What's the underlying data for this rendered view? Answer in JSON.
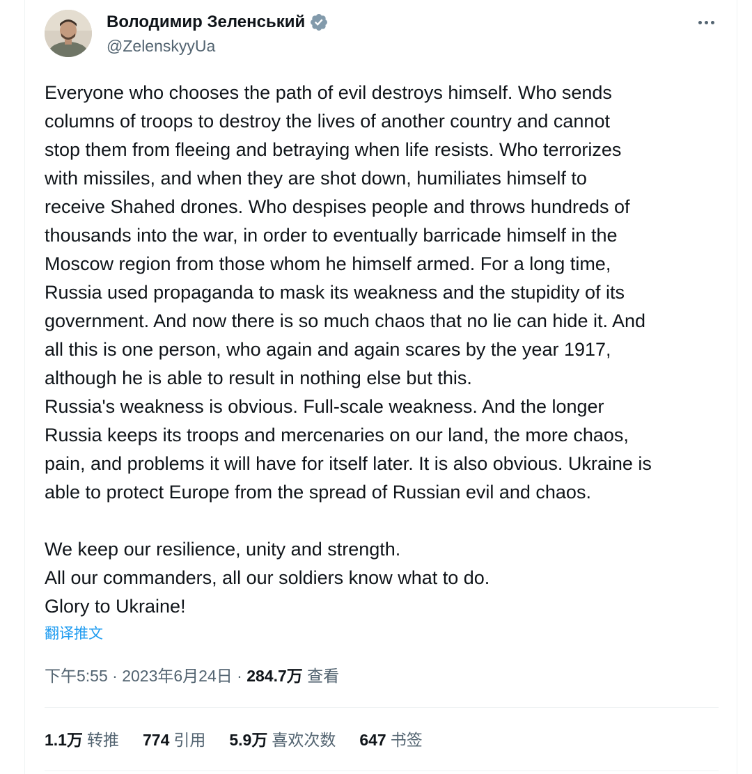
{
  "author": {
    "name": "Володимир Зеленський",
    "handle": "@ZelenskyyUa",
    "verified_icon": "verified-badge-icon",
    "avatar_icon": "avatar"
  },
  "more_icon": "more-options-icon",
  "tweet": {
    "paragraphs": [
      "Everyone who chooses the path of evil destroys himself. Who sends",
      "columns of troops to destroy the lives of another country and cannot",
      "stop them from fleeing and betraying when life resists. Who terrorizes",
      "with missiles, and when they are shot down, humiliates himself to",
      "receive Shahed drones. Who despises people and throws hundreds of",
      "thousands into the war, in order to eventually barricade himself in the",
      "Moscow region from those whom he himself armed. For a long time,",
      "Russia used propaganda to mask its weakness and the stupidity of its",
      "government. And now there is so much chaos that no lie can hide it. And",
      "all this is one person, who again and again scares by the year 1917,",
      "although he is able to result in nothing else but this.",
      "Russia's weakness is obvious. Full-scale weakness. And the longer",
      "Russia keeps its troops and mercenaries on our land, the more chaos,",
      "pain, and problems it will have for itself later. It is also obvious. Ukraine is",
      "able to protect Europe from the spread of Russian evil and chaos.",
      "",
      "We keep our resilience, unity and strength.",
      "All our commanders, all our soldiers know what to do.",
      "Glory to Ukraine!"
    ],
    "translate_label": "翻译推文"
  },
  "meta": {
    "time": "下午5:55",
    "date": "2023年6月24日",
    "separator": " · ",
    "views_count": "284.7万",
    "views_label": "查看"
  },
  "stats": {
    "retweets_count": "1.1万",
    "retweets_label": "转推",
    "quotes_count": "774",
    "quotes_label": "引用",
    "likes_count": "5.9万",
    "likes_label": "喜欢次数",
    "bookmarks_count": "647",
    "bookmarks_label": "书签"
  },
  "colors": {
    "text_primary": "#0f1419",
    "text_secondary": "#536471",
    "accent": "#1d9bf0",
    "verified_badge": "#829aab",
    "divider": "#eff3f4"
  }
}
